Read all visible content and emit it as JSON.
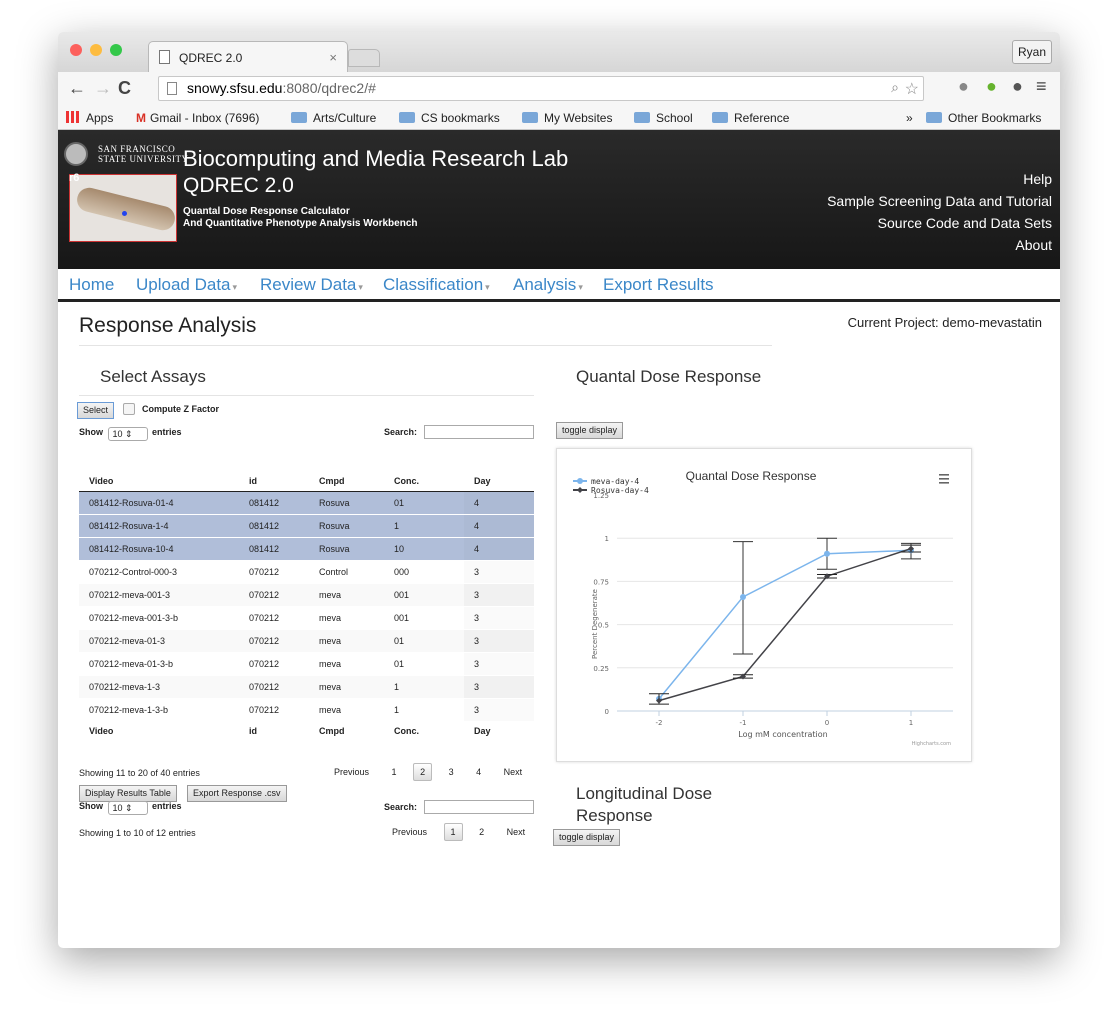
{
  "browser": {
    "tab_title": "QDREC 2.0",
    "tab_close": "×",
    "user": "Ryan",
    "url_host": "snowy.sfsu.edu",
    "url_rest": ":8080/qdrec2/#",
    "bookmarks": [
      "Apps",
      "Gmail - Inbox (7696)",
      "Arts/Culture",
      "CS bookmarks",
      "My Websites",
      "School",
      "Reference"
    ],
    "bookmarks_more": "»",
    "other_bookmarks": "Other Bookmarks"
  },
  "header": {
    "university_line1": "SAN FRANCISCO",
    "university_line2": "STATE UNIVERSITY",
    "lab_title": "Biocomputing and Media Research Lab",
    "app_title": "QDREC 2.0",
    "subtitle1": "Quantal Dose Response Calculator",
    "subtitle2": "And Quantitative Phenotype Analysis Workbench",
    "image_label": "r6",
    "links": [
      "Help",
      "Sample Screening Data and Tutorial",
      "Source Code and Data Sets",
      "About"
    ]
  },
  "menu": {
    "items": [
      "Home",
      "Upload Data",
      "Review Data",
      "Classification",
      "Analysis",
      "Export Results"
    ],
    "dropdown_marker": "▾"
  },
  "page": {
    "title": "Response Analysis",
    "current_project": "Current Project: demo-mevastatin"
  },
  "assays": {
    "title": "Select Assays",
    "select_button": "Select",
    "zfactor_label": "Compute Z Factor",
    "show": "Show",
    "entries_value": "10",
    "entries": "entries",
    "search_label": "Search:",
    "columns": [
      "Video",
      "id",
      "Cmpd",
      "Conc.",
      "Day"
    ],
    "rows": [
      [
        "081412-Rosuva-01-4",
        "081412",
        "Rosuva",
        "01",
        "4"
      ],
      [
        "081412-Rosuva-1-4",
        "081412",
        "Rosuva",
        "1",
        "4"
      ],
      [
        "081412-Rosuva-10-4",
        "081412",
        "Rosuva",
        "10",
        "4"
      ],
      [
        "070212-Control-000-3",
        "070212",
        "Control",
        "000",
        "3"
      ],
      [
        "070212-meva-001-3",
        "070212",
        "meva",
        "001",
        "3"
      ],
      [
        "070212-meva-001-3-b",
        "070212",
        "meva",
        "001",
        "3"
      ],
      [
        "070212-meva-01-3",
        "070212",
        "meva",
        "01",
        "3"
      ],
      [
        "070212-meva-01-3-b",
        "070212",
        "meva",
        "01",
        "3"
      ],
      [
        "070212-meva-1-3",
        "070212",
        "meva",
        "1",
        "3"
      ],
      [
        "070212-meva-1-3-b",
        "070212",
        "meva",
        "1",
        "3"
      ]
    ],
    "info": "Showing 11 to 20 of 40 entries",
    "pagination": {
      "previous": "Previous",
      "pages": [
        "1",
        "2",
        "3",
        "4"
      ],
      "current": "2",
      "next": "Next"
    },
    "display_results_button": "Display Results Table",
    "export_button": "Export Response .csv",
    "results_show": "Show",
    "results_entries_value": "10",
    "results_entries": "entries",
    "results_search_label": "Search:",
    "results_info": "Showing 1 to 10 of 12 entries",
    "results_pagination": {
      "previous": "Previous",
      "pages": [
        "1",
        "2"
      ],
      "current": "1",
      "next": "Next"
    }
  },
  "quantal": {
    "title": "Quantal Dose Response",
    "toggle": "toggle display"
  },
  "longitudinal": {
    "title_line1": "Longitudinal Dose",
    "title_line2": "Response",
    "toggle": "toggle display"
  },
  "chart_data": {
    "type": "line",
    "title": "Quantal Dose Response",
    "xlabel": "Log mM concentration",
    "ylabel": "Percent Degenerate",
    "xlim": [
      -2.5,
      1.5
    ],
    "ylim": [
      0,
      1.25
    ],
    "x_ticks": [
      "-2",
      "-1",
      "0",
      "1"
    ],
    "y_ticks": [
      "0",
      "0.25",
      "0.5",
      "0.75",
      "1",
      "1.25"
    ],
    "legend_position": "top-left",
    "credits": "Highcharts.com",
    "menu_icon": "hamburger-icon",
    "series": [
      {
        "name": "meva-day-4",
        "color": "#7cb5ec",
        "x": [
          -2,
          -1,
          0,
          1
        ],
        "values": [
          0.07,
          0.66,
          0.91,
          0.93
        ],
        "error_low": [
          null,
          0.33,
          0.82,
          0.88
        ],
        "error_high": [
          null,
          0.98,
          1.0,
          0.97
        ]
      },
      {
        "name": "Rosuva-day-4",
        "color": "#434348",
        "x": [
          -2,
          -1,
          0,
          1
        ],
        "values": [
          0.06,
          0.2,
          0.78,
          0.94
        ],
        "error_low": [
          0.04,
          0.19,
          0.77,
          0.92
        ],
        "error_high": [
          0.1,
          0.21,
          0.79,
          0.96
        ]
      }
    ]
  }
}
